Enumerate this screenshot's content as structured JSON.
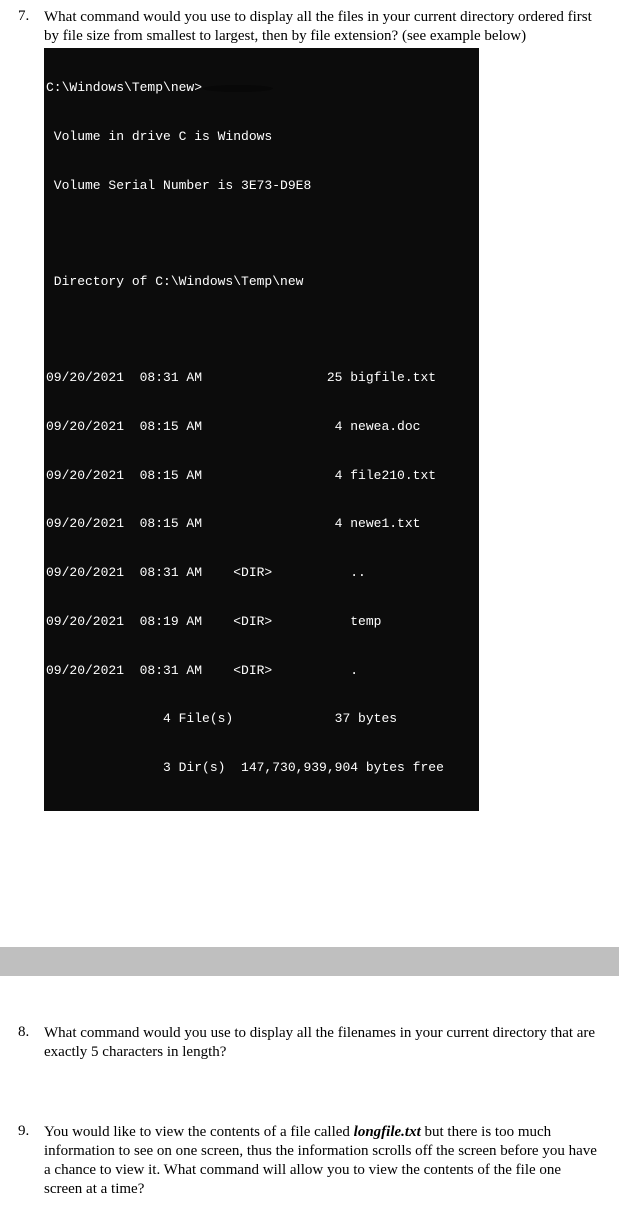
{
  "questions": {
    "q7": {
      "number": "7.",
      "text": "What command would you use to display all the files in your current directory ordered first by file size from smallest to largest, then by file extension? (see example below)"
    },
    "q8": {
      "number": "8.",
      "text": "What command would you use to display all the filenames in your current directory that are exactly 5 characters in length?"
    },
    "q9": {
      "number": "9.",
      "text_before": "You would like to view the contents of a file called ",
      "filename": "longfile.txt",
      "text_after": " but there is too much information to see on one screen, thus the information scrolls off the screen before you have a chance to view it.  What command will allow you to view the contents of the file one screen at a time?"
    }
  },
  "terminal": {
    "prompt": "C:\\Windows\\Temp\\new>",
    "volume_line": " Volume in drive C is Windows",
    "serial_line": " Volume Serial Number is 3E73-D9E8",
    "directory_line": " Directory of C:\\Windows\\Temp\\new",
    "rows": [
      "09/20/2021  08:31 AM                25 bigfile.txt",
      "09/20/2021  08:15 AM                 4 newea.doc",
      "09/20/2021  08:15 AM                 4 file210.txt",
      "09/20/2021  08:15 AM                 4 newe1.txt",
      "09/20/2021  08:31 AM    <DIR>          ..",
      "09/20/2021  08:19 AM    <DIR>          temp",
      "09/20/2021  08:31 AM    <DIR>          ."
    ],
    "summary1": "               4 File(s)             37 bytes",
    "summary2": "               3 Dir(s)  147,730,939,904 bytes free"
  }
}
